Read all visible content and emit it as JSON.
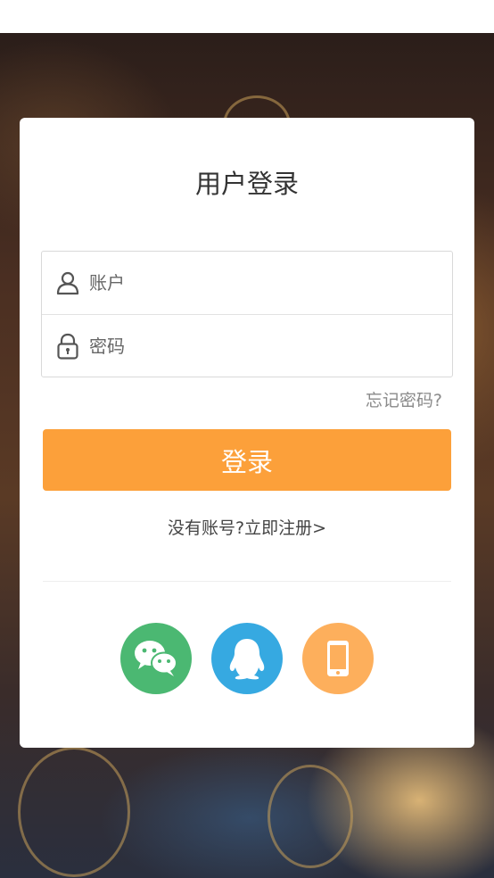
{
  "title": "用户登录",
  "form": {
    "account_placeholder": "账户",
    "password_placeholder": "密码",
    "account_icon": "user-icon",
    "password_icon": "lock-icon"
  },
  "forgot_password": "忘记密码?",
  "login_button": "登录",
  "register_prompt": "没有账号?",
  "register_link": "立即注册>",
  "social_login": [
    {
      "name": "wechat",
      "icon": "wechat-icon",
      "color": "#4bb872"
    },
    {
      "name": "qq",
      "icon": "qq-icon",
      "color": "#36a9e1"
    },
    {
      "name": "phone",
      "icon": "phone-icon",
      "color": "#fdaf5c"
    }
  ],
  "colors": {
    "primary_button": "#fca03a",
    "text": "#333333",
    "muted_text": "#8a8a8a"
  }
}
